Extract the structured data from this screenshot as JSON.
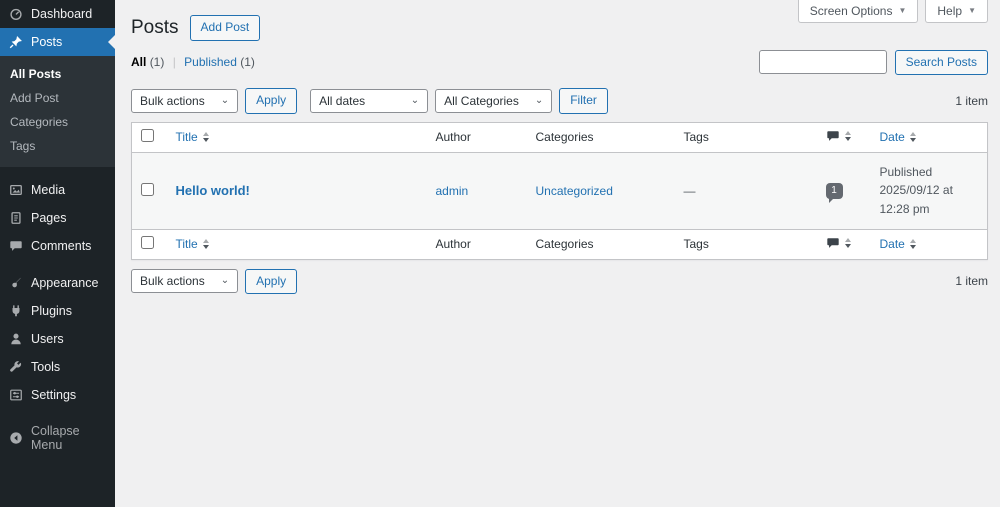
{
  "colors": {
    "accent": "#2271b1",
    "sidebar_bg": "#1d2327",
    "submenu_bg": "#2c3338",
    "content_bg": "#f0f0f1",
    "border": "#c3c4c7",
    "comment_badge_bg": "#646970"
  },
  "sidebar": {
    "items": [
      {
        "label": "Dashboard"
      },
      {
        "label": "Posts"
      },
      {
        "label": "Media"
      },
      {
        "label": "Pages"
      },
      {
        "label": "Comments"
      },
      {
        "label": "Appearance"
      },
      {
        "label": "Plugins"
      },
      {
        "label": "Users"
      },
      {
        "label": "Tools"
      },
      {
        "label": "Settings"
      },
      {
        "label": "Collapse Menu"
      }
    ],
    "posts_submenu": [
      {
        "label": "All Posts"
      },
      {
        "label": "Add Post"
      },
      {
        "label": "Categories"
      },
      {
        "label": "Tags"
      }
    ]
  },
  "header": {
    "title": "Posts",
    "add_button": "Add Post",
    "screen_options": "Screen Options",
    "help": "Help"
  },
  "views": {
    "all_label": "All",
    "all_count": "(1)",
    "separator": "|",
    "published_label": "Published",
    "published_count": "(1)"
  },
  "search": {
    "value": "",
    "button_label": "Search Posts"
  },
  "tablenav": {
    "bulk_actions": "Bulk actions",
    "apply": "Apply",
    "all_dates": "All dates",
    "all_categories": "All Categories",
    "filter": "Filter",
    "items_count": "1 item"
  },
  "table": {
    "columns": {
      "title": "Title",
      "author": "Author",
      "categories": "Categories",
      "tags": "Tags",
      "date": "Date"
    },
    "rows": [
      {
        "title": "Hello world!",
        "author": "admin",
        "categories": "Uncategorized",
        "tags": "—",
        "comments": "1",
        "date_status": "Published",
        "date_value": "2025/09/12 at 12:28 pm"
      }
    ]
  }
}
